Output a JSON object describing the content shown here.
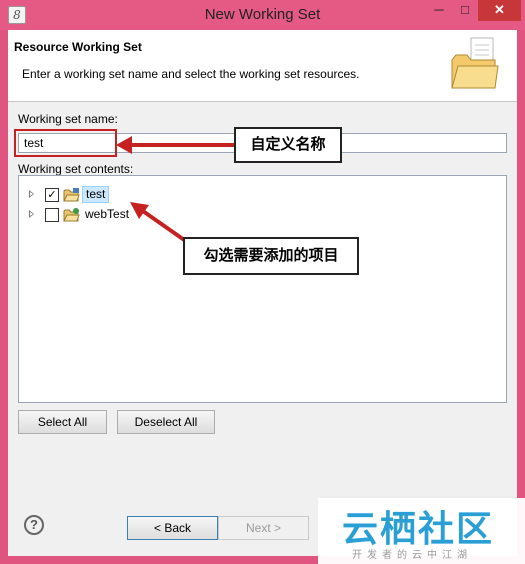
{
  "window": {
    "title": "New Working Set",
    "app_icon": "8",
    "minimize": "─",
    "maximize": "□",
    "close": "✕"
  },
  "header": {
    "title": "Resource Working Set",
    "description": "Enter a working set name and select the working set resources."
  },
  "form": {
    "name_label": "Working set name:",
    "name_value": "test",
    "contents_label": "Working set contents:"
  },
  "tree": {
    "items": [
      {
        "label": "test",
        "checked": true,
        "check_glyph": "✓",
        "selected": true
      },
      {
        "label": "webTest",
        "checked": false,
        "check_glyph": "",
        "selected": false
      }
    ]
  },
  "buttons": {
    "select_all": "Select All",
    "deselect_all": "Deselect All",
    "back": "< Back",
    "next": "Next >",
    "help": "?"
  },
  "annotations": {
    "name_callout": "自定义名称",
    "select_callout": "勾选需要添加的项目",
    "color": "#c62121"
  },
  "watermark": {
    "text": "云栖社区",
    "subtitle": "开发者的云中江湖"
  },
  "colors": {
    "window_frame": "#e0557f",
    "close_button": "#c7373a",
    "selection": "#cce8ff"
  }
}
